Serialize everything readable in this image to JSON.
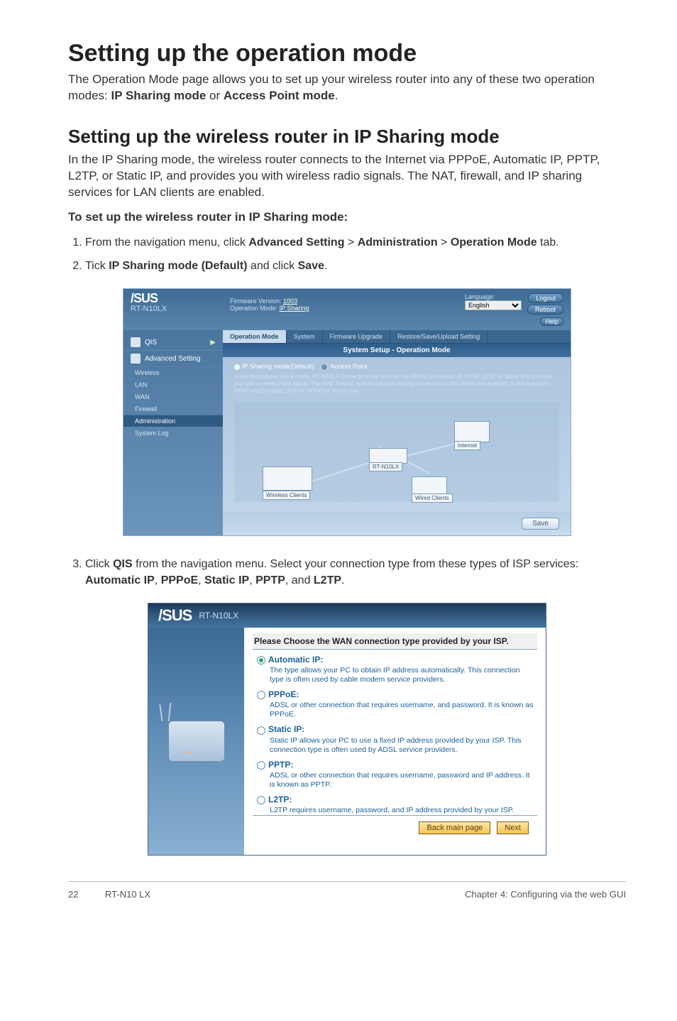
{
  "page": {
    "h1": "Setting up the operation mode",
    "lead_pre": "The Operation Mode page allows you to set up your wireless router into any of these two operation modes: ",
    "lead_b1": "IP Sharing mode",
    "lead_mid": " or ",
    "lead_b2": "Access Point mode",
    "lead_post": ".",
    "h2": "Setting up the wireless router in IP Sharing mode",
    "sub": "In the IP Sharing mode, the wireless router connects to the Internet via PPPoE, Automatic IP, PPTP, L2TP, or Static IP, and provides you with wireless radio signals. The NAT, firewall, and IP sharing services for LAN clients are enabled.",
    "to_set": "To set up the wireless router in IP Sharing mode:",
    "steps": {
      "s1_a": "From the navigation menu, click ",
      "s1_b1": "Advanced Setting",
      "s1_gt1": " > ",
      "s1_b2": "Administration",
      "s1_gt2": " > ",
      "s1_b3": "Operation Mode",
      "s1_c": " tab.",
      "s2_a": "Tick ",
      "s2_b": "IP Sharing mode (Default)",
      "s2_c": " and click ",
      "s2_d": "Save",
      "s2_e": ".",
      "s3_a": "Click ",
      "s3_b": "QIS",
      "s3_c": " from the navigation menu. Select your connection type from these types of ISP services: ",
      "s3_l1": "Automatic IP",
      "s3_sep1": ", ",
      "s3_l2": "PPPoE",
      "s3_sep2": ", ",
      "s3_l3": "Static IP",
      "s3_sep3": ", ",
      "s3_l4": "PPTP",
      "s3_sep4": ", and ",
      "s3_l5": "L2TP",
      "s3_end": "."
    }
  },
  "router": {
    "model": "RT-N10LX",
    "fw_label": "Firmware Version:",
    "fw_val": "1003",
    "opmode_label1": "Operation Mode:",
    "opmode_val": "IP Sharing",
    "lang_label": "Language:",
    "lang_val": "English",
    "btn_logout": "Logout",
    "btn_reboot": "Reboot",
    "btn_help": "Help",
    "nav_qis": "QIS",
    "nav_adv": "Advanced Setting",
    "nav_items": [
      "Wireless",
      "LAN",
      "WAN",
      "Firewall",
      "Administration",
      "System Log"
    ],
    "tabs": [
      "Operation Mode",
      "System",
      "Firmware Upgrade",
      "Restore/Save/Upload Setting"
    ],
    "title_bar": "System Setup - Operation Mode",
    "radio_ip": "IP Sharing mode(Default)",
    "radio_ap": "Access Point",
    "desc": "In the Brodaband share mode, RT-N10LX connects to the Internet via PPPoE,Automatic IP, PPTP, L2TP, or Static IP.It provides you with wireless radio signal. The NAT, firewall, and broadband sharing services for LAN clients are enabled. It also supports UPnP and Dynamic DNS for SOHO or home user.",
    "diagram": {
      "wireless": "Wireless Clients",
      "router": "RT-N10LX",
      "wired": "Wired Clients",
      "internet": "Internet"
    },
    "save": "Save"
  },
  "qis": {
    "model": "RT-N10LX",
    "title": "Please Choose the WAN connection type provided by your ISP.",
    "options": [
      {
        "label": "Automatic IP:",
        "desc": "The type allows your PC to obtain IP address automatically. This connection type is often used by cable modem service providers.",
        "selected": true
      },
      {
        "label": "PPPoE:",
        "desc": "ADSL or other connection that requires username, and password. It is known as PPPoE.",
        "selected": false
      },
      {
        "label": "Static IP:",
        "desc": "Static IP allows your PC to use a fixed IP address provided by your ISP. This connection type is often used by ADSL service providers.",
        "selected": false
      },
      {
        "label": "PPTP:",
        "desc": "ADSL or other connection that requires username, password and IP address. It is known as PPTP.",
        "selected": false
      },
      {
        "label": "L2TP:",
        "desc": "L2TP requires username, password, and IP address provided by your ISP.",
        "selected": false
      }
    ],
    "btn_back": "Back main page",
    "btn_next": "Next"
  },
  "footer": {
    "page_no": "22",
    "model": "RT-N10 LX",
    "chapter": "Chapter 4: Configuring via the web GUI"
  }
}
